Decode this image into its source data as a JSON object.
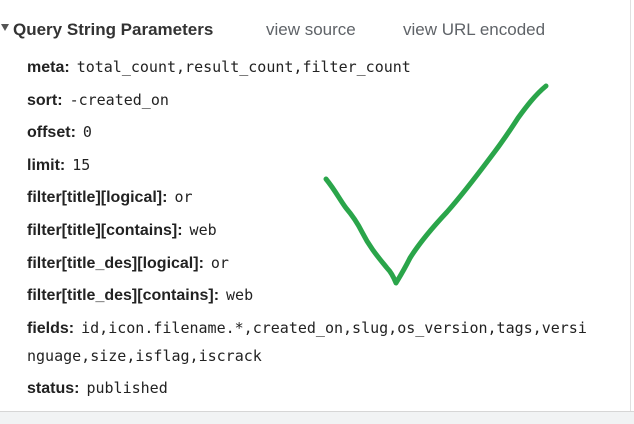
{
  "header": {
    "title": "Query String Parameters",
    "view_source_label": "view source",
    "view_url_encoded_label": "view URL encoded"
  },
  "params": [
    {
      "key": "meta",
      "value": "total_count,result_count,filter_count"
    },
    {
      "key": "sort",
      "value": "-created_on"
    },
    {
      "key": "offset",
      "value": "0"
    },
    {
      "key": "limit",
      "value": "15"
    },
    {
      "key": "filter[title][logical]",
      "value": "or"
    },
    {
      "key": "filter[title][contains]",
      "value": "web"
    },
    {
      "key": "filter[title_des][logical]",
      "value": "or"
    },
    {
      "key": "filter[title_des][contains]",
      "value": "web"
    },
    {
      "key": "fields",
      "value": "id,icon.filename.*,created_on,slug,os_version,tags,versi"
    }
  ],
  "fields_continuation": "nguage,size,isflag,iscrack",
  "status": {
    "key": "status",
    "value": "published"
  },
  "annotation": {
    "type": "green-checkmark",
    "color": "#2aa54a"
  },
  "colors": {
    "link": "#5f6368",
    "text": "#222222",
    "checkmark": "#2aa54a"
  }
}
